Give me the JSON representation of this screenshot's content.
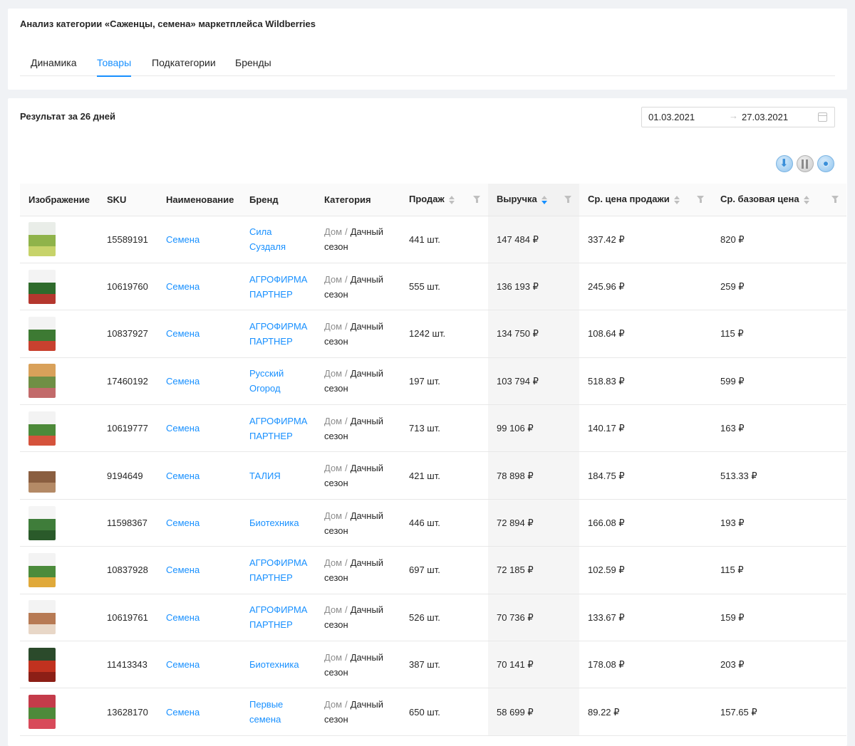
{
  "header": {
    "title": "Анализ категории «Саженцы, семена» маркетплейса Wildberries",
    "tabs": [
      {
        "label": "Динамика",
        "active": false
      },
      {
        "label": "Товары",
        "active": true
      },
      {
        "label": "Подкатегории",
        "active": false
      },
      {
        "label": "Бренды",
        "active": false
      }
    ]
  },
  "main": {
    "result_title": "Результат за 26 дней",
    "date_from": "01.03.2021",
    "date_to": "27.03.2021",
    "arrow": "→",
    "toolbar": [
      "download-icon",
      "columns-icon",
      "settings-icon"
    ]
  },
  "table": {
    "columns": [
      "Изображение",
      "SKU",
      "Наименование",
      "Бренд",
      "Категория",
      "Продаж",
      "Выручка",
      "Ср. цена продажи",
      "Ср. базовая цена"
    ],
    "category": {
      "parent": "Дом",
      "separator": "/",
      "child": "Дачный сезон"
    },
    "rows": [
      {
        "sku": "15589191",
        "name": "Семена",
        "brand": "Сила Суздаля",
        "sales": "441 шт.",
        "revenue": "147 484 ₽",
        "avg_price": "337.42 ₽",
        "base_price": "820 ₽",
        "thumb": [
          "#e9ede8",
          "#8fb34a",
          "#c7d36a"
        ]
      },
      {
        "sku": "10619760",
        "name": "Семена",
        "brand": "АГРОФИРМА ПАРТНЕР",
        "sales": "555 шт.",
        "revenue": "136 193 ₽",
        "avg_price": "245.96 ₽",
        "base_price": "259 ₽",
        "thumb": [
          "#f3f3f3",
          "#2f6b2c",
          "#b5372e"
        ]
      },
      {
        "sku": "10837927",
        "name": "Семена",
        "brand": "АГРОФИРМА ПАРТНЕР",
        "sales": "1242 шт.",
        "revenue": "134 750 ₽",
        "avg_price": "108.64 ₽",
        "base_price": "115 ₽",
        "thumb": [
          "#f3f3f3",
          "#3d7a33",
          "#c8412f"
        ]
      },
      {
        "sku": "17460192",
        "name": "Семена",
        "brand": "Русский Огород",
        "sales": "197 шт.",
        "revenue": "103 794 ₽",
        "avg_price": "518.83 ₽",
        "base_price": "599 ₽",
        "thumb": [
          "#d9a15a",
          "#6f8f45",
          "#c26a6a"
        ]
      },
      {
        "sku": "10619777",
        "name": "Семена",
        "brand": "АГРОФИРМА ПАРТНЕР",
        "sales": "713 шт.",
        "revenue": "99 106 ₽",
        "avg_price": "140.17 ₽",
        "base_price": "163 ₽",
        "thumb": [
          "#f3f3f3",
          "#4d8a3a",
          "#d5533c"
        ]
      },
      {
        "sku": "9194649",
        "name": "Семена",
        "brand": "ТАЛИЯ",
        "sales": "421 шт.",
        "revenue": "78 898 ₽",
        "avg_price": "184.75 ₽",
        "base_price": "513.33 ₽",
        "thumb": [
          "#ffffff",
          "#8a5e40",
          "#b48a66"
        ]
      },
      {
        "sku": "11598367",
        "name": "Семена",
        "brand": "Биотехника",
        "sales": "446 шт.",
        "revenue": "72 894 ₽",
        "avg_price": "166.08 ₽",
        "base_price": "193 ₽",
        "thumb": [
          "#f5f5f5",
          "#3f7d3a",
          "#2a5a2a"
        ]
      },
      {
        "sku": "10837928",
        "name": "Семена",
        "brand": "АГРОФИРМА ПАРТНЕР",
        "sales": "697 шт.",
        "revenue": "72 185 ₽",
        "avg_price": "102.59 ₽",
        "base_price": "115 ₽",
        "thumb": [
          "#f3f3f3",
          "#4b8b3b",
          "#e0a93a"
        ]
      },
      {
        "sku": "10619761",
        "name": "Семена",
        "brand": "АГРОФИРМА ПАРТНЕР",
        "sales": "526 шт.",
        "revenue": "70 736 ₽",
        "avg_price": "133.67 ₽",
        "base_price": "159 ₽",
        "thumb": [
          "#f3f3f3",
          "#b77a54",
          "#e8d7c7"
        ]
      },
      {
        "sku": "11413343",
        "name": "Семена",
        "brand": "Биотехника",
        "sales": "387 шт.",
        "revenue": "70 141 ₽",
        "avg_price": "178.08 ₽",
        "base_price": "203 ₽",
        "thumb": [
          "#2b4a2b",
          "#c1321f",
          "#8c1f16"
        ]
      },
      {
        "sku": "13628170",
        "name": "Семена",
        "brand": "Первые семена",
        "sales": "650 шт.",
        "revenue": "58 699 ₽",
        "avg_price": "89.22 ₽",
        "base_price": "157.65 ₽",
        "thumb": [
          "#c43b4a",
          "#4e8a3a",
          "#d84a5a"
        ]
      }
    ]
  },
  "colors": {
    "accent": "#1890ff",
    "text": "#262626",
    "muted": "#8c8c8c",
    "border": "#e8e8e8"
  }
}
